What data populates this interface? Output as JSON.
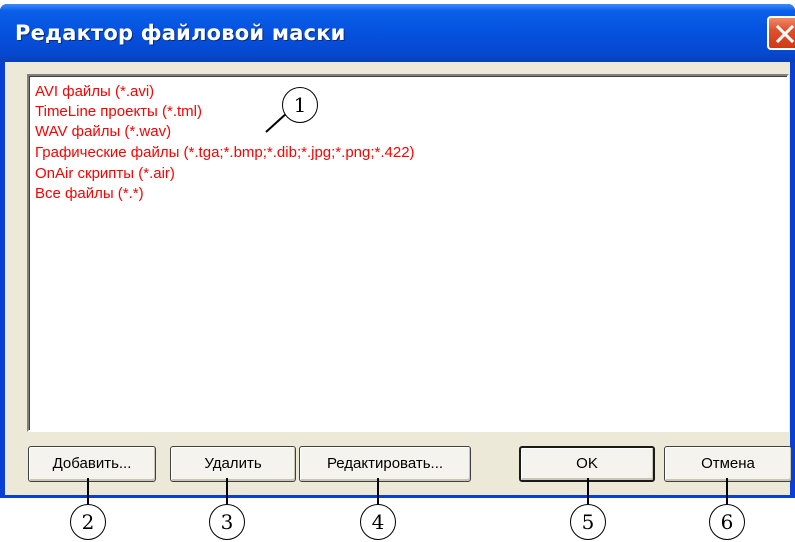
{
  "window": {
    "title": "Редактор файловой маски"
  },
  "mask_list": {
    "items": [
      "AVI файлы (*.avi)",
      "TimeLine проекты (*.tml)",
      "WAV файлы (*.wav)",
      "Графические файлы (*.tga;*.bmp;*.dib;*.jpg;*.png;*.422)",
      "OnAir скрипты (*.air)",
      "Все файлы (*.*)"
    ],
    "item_color": "#ff0000"
  },
  "buttons": {
    "add": "Добавить...",
    "delete": "Удалить",
    "edit": "Редактировать...",
    "ok": "OK",
    "cancel": "Отмена"
  },
  "callouts": [
    "1",
    "2",
    "3",
    "4",
    "5",
    "6"
  ],
  "colors": {
    "titlebar": "#0553e0",
    "dialog_bg": "#ece9d8",
    "close_button": "#e0502c"
  },
  "icons": {
    "close": "close-icon"
  }
}
